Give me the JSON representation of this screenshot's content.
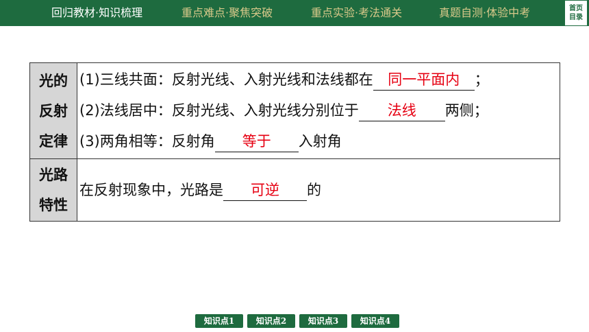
{
  "nav": {
    "items": [
      "回归教材·知识梳理",
      "重点难点·聚焦突破",
      "重点实验·考法通关",
      "真题自测·体验中考"
    ],
    "home": "首页",
    "toc": "目录"
  },
  "table": {
    "row1": {
      "header": [
        "光的",
        "反射",
        "定律"
      ],
      "lines": [
        {
          "prefix": "(1)三线共面：反射光线、入射光线和法线都在",
          "answer": "同一平面内",
          "suffix": "；"
        },
        {
          "prefix": "(2)法线居中：反射光线、入射光线分别位于",
          "answer": "法线",
          "suffix": "两侧；"
        },
        {
          "prefix": "(3)两角相等：反射角",
          "answer": "等于",
          "suffix": "入射角"
        }
      ]
    },
    "row2": {
      "header": [
        "光路",
        "特性"
      ],
      "line": {
        "prefix": "在反射现象中，光路是",
        "answer": "可逆",
        "suffix": "的"
      }
    }
  },
  "bottom_nav": [
    "知识点1",
    "知识点2",
    "知识点3",
    "知识点4"
  ],
  "colors": {
    "bar": "#1e6b3f",
    "answer": "#e60012",
    "nav_inactive": "#d9c98a"
  }
}
